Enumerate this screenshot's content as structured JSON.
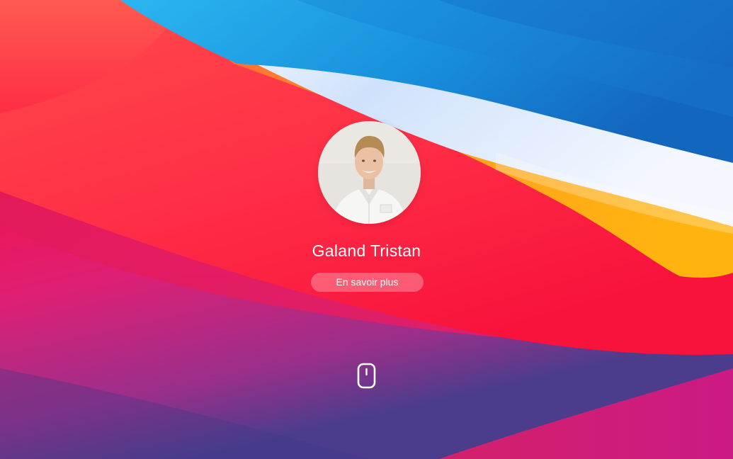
{
  "login": {
    "user_name": "Galand Tristan",
    "learn_more_label": "En savoir plus"
  },
  "icons": {
    "scroll": "mouse-scroll-icon"
  },
  "colors": {
    "text": "#ffffff",
    "sky_blue": "#1e9fe3",
    "red": "#f5203f",
    "orange": "#ffae18",
    "magenta": "#d91f7a",
    "purple": "#5b3f8a"
  }
}
